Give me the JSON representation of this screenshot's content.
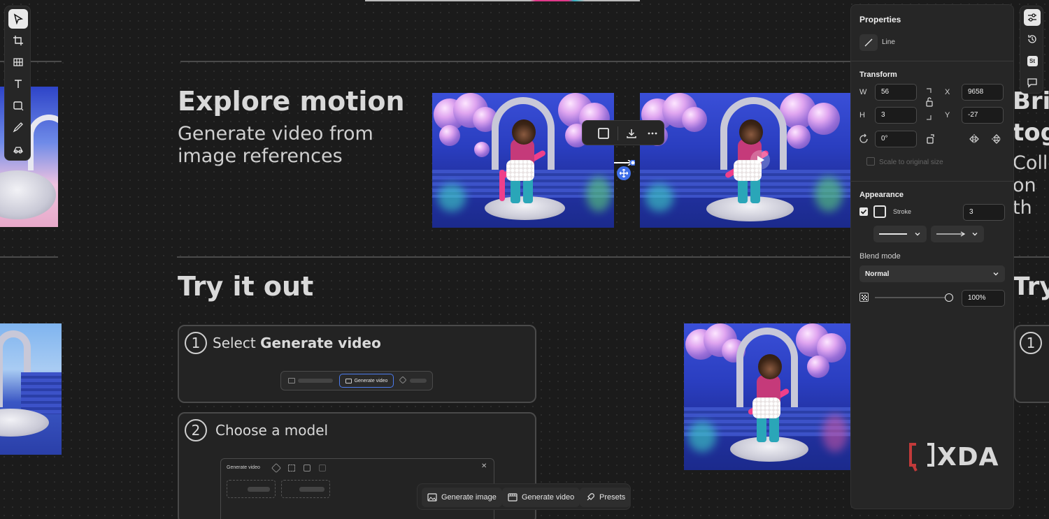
{
  "canvas": {
    "section1": {
      "heading": "Explore motion",
      "subheading_line1": "Generate video from",
      "subheading_line2": "image references"
    },
    "section2": {
      "heading": "Try it out"
    },
    "right_partial": {
      "heading_top_line1": "Bri",
      "heading_top_line2": "tog",
      "sub_line1": "Colle",
      "sub_line2": "on th",
      "heading_bottom": "Try",
      "step_number": "1"
    },
    "steps": [
      {
        "number": "1",
        "prefix": "Select ",
        "bold": "Generate video"
      },
      {
        "number": "2",
        "prefix": "Choose a model",
        "bold": ""
      }
    ],
    "step1_preview": {
      "active_button": "Generate video"
    },
    "step2_preview": {
      "title": "Generate video"
    }
  },
  "mini_toolbar": {
    "items": [
      "square-icon",
      "download-icon",
      "more-icon"
    ]
  },
  "bottom_toolbar": {
    "generate_image": "Generate image",
    "generate_video": "Generate video",
    "presets": "Presets"
  },
  "properties": {
    "title": "Properties",
    "object_type": "Line",
    "transform": {
      "title": "Transform",
      "w_label": "W",
      "w_value": "56",
      "h_label": "H",
      "h_value": "3",
      "x_label": "X",
      "x_value": "9658",
      "y_label": "Y",
      "y_value": "-27",
      "rotation_value": "0°",
      "scale_to_original": "Scale to original size"
    },
    "appearance": {
      "title": "Appearance",
      "stroke_label": "Stroke",
      "stroke_value": "3",
      "stroke_checked": true,
      "blend_mode_label": "Blend mode",
      "blend_mode_value": "Normal",
      "opacity_value": "100%",
      "opacity_fraction": 1.0
    }
  },
  "watermark": {
    "text": "XDA"
  },
  "colors": {
    "accent": "#3f6fe8",
    "panel_bg": "#262626",
    "canvas_bg": "#1b1b1b"
  }
}
